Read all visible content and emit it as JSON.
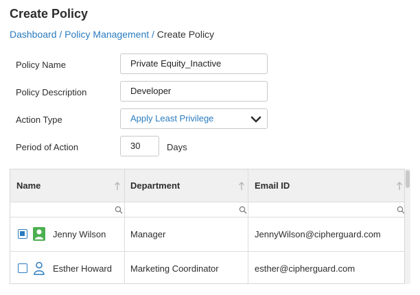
{
  "page_title": "Create Policy",
  "breadcrumb": {
    "items": [
      "Dashboard",
      "Policy Management"
    ],
    "separator": "/",
    "current": "Create Policy"
  },
  "form": {
    "policy_name": {
      "label": "Policy Name",
      "value": "Private Equity_Inactive"
    },
    "policy_description": {
      "label": "Policy Description",
      "value": "Developer"
    },
    "action_type": {
      "label": "Action Type",
      "value": "Apply Least Privilege"
    },
    "period_of_action": {
      "label": "Period of Action",
      "value": "30",
      "unit": "Days"
    }
  },
  "table": {
    "columns": [
      "Name",
      "Department",
      "Email ID"
    ],
    "rows": [
      {
        "checked": true,
        "avatar": "user-filled-icon",
        "name": "Jenny Wilson",
        "department": "Manager",
        "email": "JennyWilson@cipherguard.com"
      },
      {
        "checked": false,
        "avatar": "user-outline-icon",
        "name": "Esther Howard",
        "department": "Marketing Coordinator",
        "email": "esther@cipherguard.com"
      }
    ]
  },
  "colors": {
    "link": "#2a7bbf",
    "avatar_green": "#4caf50",
    "header_bg": "#f0f0f0"
  }
}
